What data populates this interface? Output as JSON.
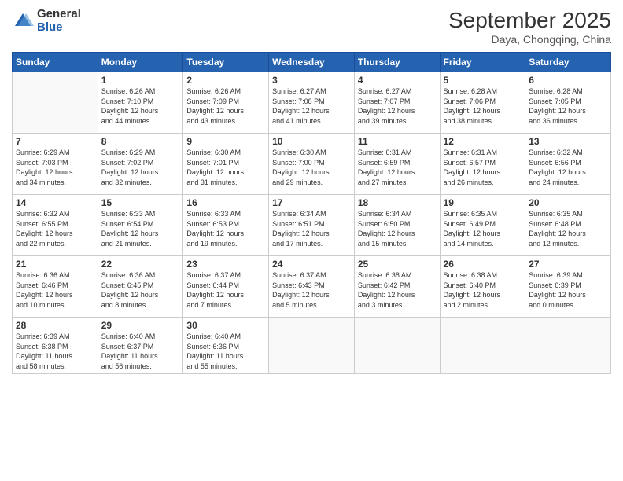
{
  "header": {
    "logo_general": "General",
    "logo_blue": "Blue",
    "month_title": "September 2025",
    "subtitle": "Daya, Chongqing, China"
  },
  "weekdays": [
    "Sunday",
    "Monday",
    "Tuesday",
    "Wednesday",
    "Thursday",
    "Friday",
    "Saturday"
  ],
  "weeks": [
    [
      {
        "day": "",
        "info": ""
      },
      {
        "day": "1",
        "info": "Sunrise: 6:26 AM\nSunset: 7:10 PM\nDaylight: 12 hours\nand 44 minutes."
      },
      {
        "day": "2",
        "info": "Sunrise: 6:26 AM\nSunset: 7:09 PM\nDaylight: 12 hours\nand 43 minutes."
      },
      {
        "day": "3",
        "info": "Sunrise: 6:27 AM\nSunset: 7:08 PM\nDaylight: 12 hours\nand 41 minutes."
      },
      {
        "day": "4",
        "info": "Sunrise: 6:27 AM\nSunset: 7:07 PM\nDaylight: 12 hours\nand 39 minutes."
      },
      {
        "day": "5",
        "info": "Sunrise: 6:28 AM\nSunset: 7:06 PM\nDaylight: 12 hours\nand 38 minutes."
      },
      {
        "day": "6",
        "info": "Sunrise: 6:28 AM\nSunset: 7:05 PM\nDaylight: 12 hours\nand 36 minutes."
      }
    ],
    [
      {
        "day": "7",
        "info": "Sunrise: 6:29 AM\nSunset: 7:03 PM\nDaylight: 12 hours\nand 34 minutes."
      },
      {
        "day": "8",
        "info": "Sunrise: 6:29 AM\nSunset: 7:02 PM\nDaylight: 12 hours\nand 32 minutes."
      },
      {
        "day": "9",
        "info": "Sunrise: 6:30 AM\nSunset: 7:01 PM\nDaylight: 12 hours\nand 31 minutes."
      },
      {
        "day": "10",
        "info": "Sunrise: 6:30 AM\nSunset: 7:00 PM\nDaylight: 12 hours\nand 29 minutes."
      },
      {
        "day": "11",
        "info": "Sunrise: 6:31 AM\nSunset: 6:59 PM\nDaylight: 12 hours\nand 27 minutes."
      },
      {
        "day": "12",
        "info": "Sunrise: 6:31 AM\nSunset: 6:57 PM\nDaylight: 12 hours\nand 26 minutes."
      },
      {
        "day": "13",
        "info": "Sunrise: 6:32 AM\nSunset: 6:56 PM\nDaylight: 12 hours\nand 24 minutes."
      }
    ],
    [
      {
        "day": "14",
        "info": "Sunrise: 6:32 AM\nSunset: 6:55 PM\nDaylight: 12 hours\nand 22 minutes."
      },
      {
        "day": "15",
        "info": "Sunrise: 6:33 AM\nSunset: 6:54 PM\nDaylight: 12 hours\nand 21 minutes."
      },
      {
        "day": "16",
        "info": "Sunrise: 6:33 AM\nSunset: 6:53 PM\nDaylight: 12 hours\nand 19 minutes."
      },
      {
        "day": "17",
        "info": "Sunrise: 6:34 AM\nSunset: 6:51 PM\nDaylight: 12 hours\nand 17 minutes."
      },
      {
        "day": "18",
        "info": "Sunrise: 6:34 AM\nSunset: 6:50 PM\nDaylight: 12 hours\nand 15 minutes."
      },
      {
        "day": "19",
        "info": "Sunrise: 6:35 AM\nSunset: 6:49 PM\nDaylight: 12 hours\nand 14 minutes."
      },
      {
        "day": "20",
        "info": "Sunrise: 6:35 AM\nSunset: 6:48 PM\nDaylight: 12 hours\nand 12 minutes."
      }
    ],
    [
      {
        "day": "21",
        "info": "Sunrise: 6:36 AM\nSunset: 6:46 PM\nDaylight: 12 hours\nand 10 minutes."
      },
      {
        "day": "22",
        "info": "Sunrise: 6:36 AM\nSunset: 6:45 PM\nDaylight: 12 hours\nand 8 minutes."
      },
      {
        "day": "23",
        "info": "Sunrise: 6:37 AM\nSunset: 6:44 PM\nDaylight: 12 hours\nand 7 minutes."
      },
      {
        "day": "24",
        "info": "Sunrise: 6:37 AM\nSunset: 6:43 PM\nDaylight: 12 hours\nand 5 minutes."
      },
      {
        "day": "25",
        "info": "Sunrise: 6:38 AM\nSunset: 6:42 PM\nDaylight: 12 hours\nand 3 minutes."
      },
      {
        "day": "26",
        "info": "Sunrise: 6:38 AM\nSunset: 6:40 PM\nDaylight: 12 hours\nand 2 minutes."
      },
      {
        "day": "27",
        "info": "Sunrise: 6:39 AM\nSunset: 6:39 PM\nDaylight: 12 hours\nand 0 minutes."
      }
    ],
    [
      {
        "day": "28",
        "info": "Sunrise: 6:39 AM\nSunset: 6:38 PM\nDaylight: 11 hours\nand 58 minutes."
      },
      {
        "day": "29",
        "info": "Sunrise: 6:40 AM\nSunset: 6:37 PM\nDaylight: 11 hours\nand 56 minutes."
      },
      {
        "day": "30",
        "info": "Sunrise: 6:40 AM\nSunset: 6:36 PM\nDaylight: 11 hours\nand 55 minutes."
      },
      {
        "day": "",
        "info": ""
      },
      {
        "day": "",
        "info": ""
      },
      {
        "day": "",
        "info": ""
      },
      {
        "day": "",
        "info": ""
      }
    ]
  ]
}
